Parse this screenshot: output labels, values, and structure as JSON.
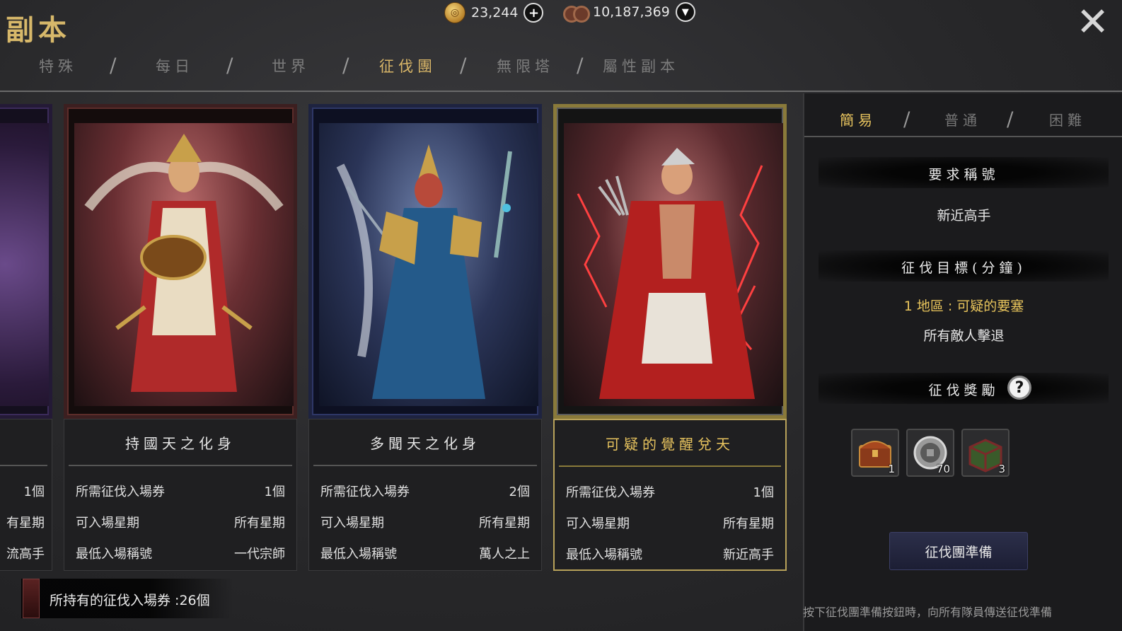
{
  "header": {
    "title": "副本",
    "gold_amount": "23,244",
    "copper_amount": "10,187,369",
    "add_icon": "plus-icon",
    "dropdown_icon": "chevron-down-icon",
    "close_icon": "close-icon",
    "close_glyph": "✕"
  },
  "tabs": [
    {
      "label": "特殊"
    },
    {
      "label": "每日"
    },
    {
      "label": "世界"
    },
    {
      "label": "征伐團",
      "active": true
    },
    {
      "label": "無限塔"
    },
    {
      "label": "屬性副本"
    }
  ],
  "tab_separator": "/",
  "partial_card": {
    "r1_value": "1個",
    "r2_value": "有星期",
    "r3_value": "流高手"
  },
  "cards": [
    {
      "name": "持國天之化身",
      "r1_label": "所需征伐入場券",
      "r1_value": "1個",
      "r2_label": "可入場星期",
      "r2_value": "所有星期",
      "r3_label": "最低入場稱號",
      "r3_value": "一代宗師"
    },
    {
      "name": "多聞天之化身",
      "r1_label": "所需征伐入場券",
      "r1_value": "2個",
      "r2_label": "可入場星期",
      "r2_value": "所有星期",
      "r3_label": "最低入場稱號",
      "r3_value": "萬人之上"
    },
    {
      "name": "可疑的覺醒兌天",
      "r1_label": "所需征伐入場券",
      "r1_value": "1個",
      "r2_label": "可入場星期",
      "r2_value": "所有星期",
      "r3_label": "最低入場稱號",
      "r3_value": "新近高手",
      "selected": true
    }
  ],
  "panel": {
    "difficulty": [
      {
        "label": "簡易",
        "active": true
      },
      {
        "label": "普通"
      },
      {
        "label": "困難"
      }
    ],
    "required_title_heading": "要求稱號",
    "required_title_value": "新近高手",
    "objective_heading": "征伐目標(分鐘)",
    "objective_line1": "1 地區 : 可疑的要塞",
    "objective_line2": "所有敵人擊退",
    "reward_heading": "征伐獎勵",
    "help_glyph": "?",
    "rewards": [
      {
        "icon": "treasure-chest-icon",
        "qty": "1"
      },
      {
        "icon": "coin-icon",
        "qty": "70"
      },
      {
        "icon": "box-icon",
        "qty": "3"
      }
    ],
    "ready_button": "征伐團準備",
    "hint": "按下征伐團準備按鈕時，向所有隊員傳送征伐準備"
  },
  "ticket_bar": {
    "text": "所持有的征伐入場券 :26個"
  },
  "colors": {
    "accent_gold": "#e7c35e",
    "panel_bg": "#1b1b1d",
    "button_bg": "#2c2f4a"
  }
}
